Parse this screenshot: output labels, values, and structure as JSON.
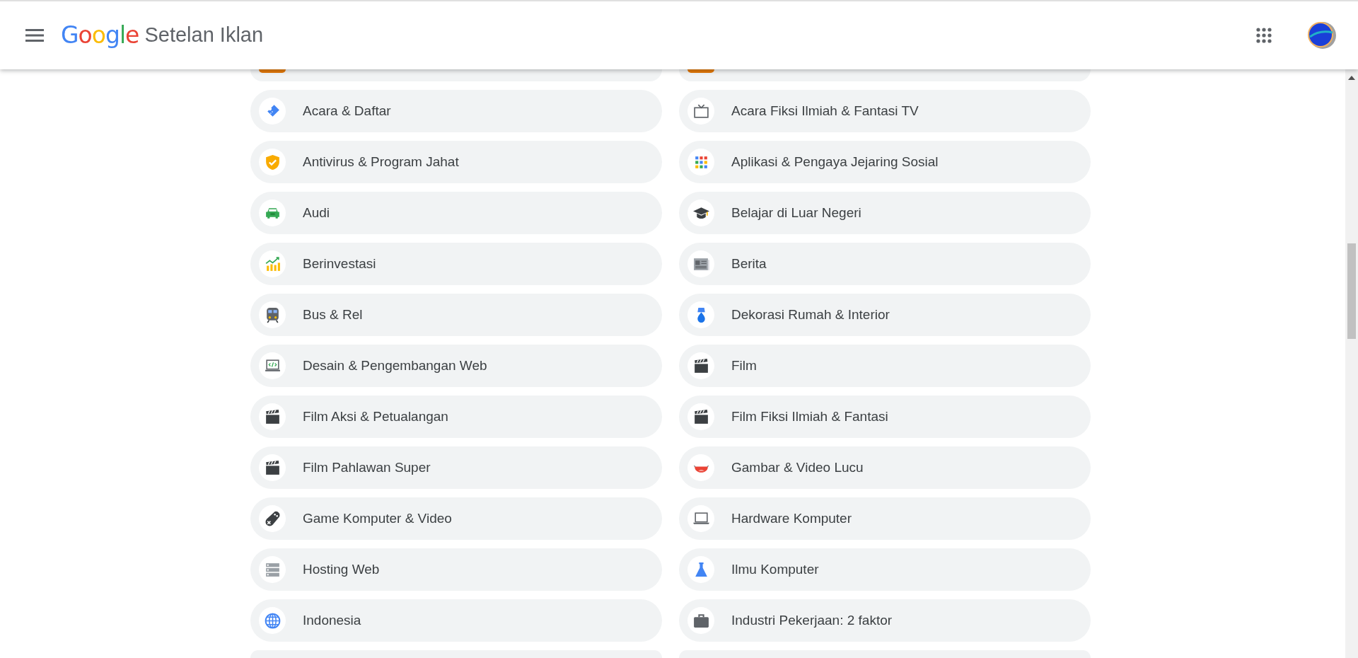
{
  "header": {
    "logo": "Google",
    "title": "Setelan Iklan"
  },
  "topics": [
    {
      "kind": "cut-top"
    },
    {
      "kind": "cut-top"
    },
    {
      "label": "Acara & Daftar",
      "kind": "ticket"
    },
    {
      "label": "Acara Fiksi Ilmiah & Fantasi TV",
      "kind": "tv"
    },
    {
      "label": "Antivirus & Program Jahat",
      "kind": "shield"
    },
    {
      "label": "Aplikasi & Pengaya Jejaring Sosial",
      "kind": "apps"
    },
    {
      "label": "Audi",
      "kind": "car"
    },
    {
      "label": "Belajar di Luar Negeri",
      "kind": "graduation"
    },
    {
      "label": "Berinvestasi",
      "kind": "chart"
    },
    {
      "label": "Berita",
      "kind": "newspaper"
    },
    {
      "label": "Bus & Rel",
      "kind": "train"
    },
    {
      "label": "Dekorasi Rumah & Interior",
      "kind": "lamp"
    },
    {
      "label": "Desain & Pengembangan Web",
      "kind": "code"
    },
    {
      "label": "Film",
      "kind": "clapper"
    },
    {
      "label": "Film Aksi & Petualangan",
      "kind": "clapper"
    },
    {
      "label": "Film Fiksi Ilmiah & Fantasi",
      "kind": "clapper"
    },
    {
      "label": "Film Pahlawan Super",
      "kind": "clapper"
    },
    {
      "label": "Gambar & Video Lucu",
      "kind": "laugh"
    },
    {
      "label": "Game Komputer & Video",
      "kind": "gamepad"
    },
    {
      "label": "Hardware Komputer",
      "kind": "laptop"
    },
    {
      "label": "Hosting Web",
      "kind": "server"
    },
    {
      "label": "Ilmu Komputer",
      "kind": "flask"
    },
    {
      "label": "Indonesia",
      "kind": "globe"
    },
    {
      "label": "Industri Pekerjaan: 2 faktor",
      "kind": "briefcase"
    },
    {
      "kind": "cut-bottom"
    },
    {
      "kind": "cut-bottom"
    }
  ]
}
